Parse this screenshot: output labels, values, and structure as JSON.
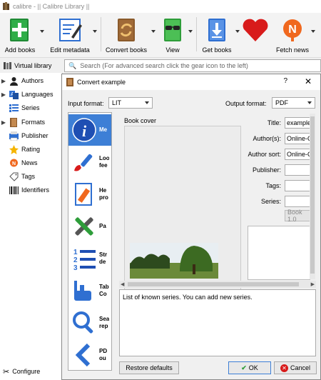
{
  "app": {
    "title": "calibre - || Calibre Library ||"
  },
  "toolbar": {
    "add_books": "Add books",
    "edit_metadata": "Edit metadata",
    "convert_books": "Convert books",
    "view": "View",
    "get_books": "Get books",
    "fetch_news": "Fetch news"
  },
  "search": {
    "virtual_library": "Virtual library",
    "placeholder": "Search (For advanced search click the gear icon to the left)"
  },
  "sidebar": {
    "items": [
      {
        "label": "Authors",
        "icon": "person-icon"
      },
      {
        "label": "Languages",
        "icon": "languages-icon"
      },
      {
        "label": "Series",
        "icon": "series-icon"
      },
      {
        "label": "Formats",
        "icon": "book-icon"
      },
      {
        "label": "Publisher",
        "icon": "publisher-icon"
      },
      {
        "label": "Rating",
        "icon": "star-icon"
      },
      {
        "label": "News",
        "icon": "news-icon"
      },
      {
        "label": "Tags",
        "icon": "tag-icon"
      },
      {
        "label": "Identifiers",
        "icon": "barcode-icon"
      }
    ],
    "configure": "Configure"
  },
  "dialog": {
    "title": "Convert example",
    "help": "?",
    "close": "✕",
    "input_format_label": "Input format:",
    "input_format_value": "LIT",
    "output_format_label": "Output format:",
    "output_format_value": "PDF",
    "categories": [
      {
        "label": "Me",
        "icon": "info-icon"
      },
      {
        "label": "Loo fee",
        "icon": "brush-icon"
      },
      {
        "label": "He pro",
        "icon": "page-setup-icon"
      },
      {
        "label": "Pa",
        "icon": "tools-icon"
      },
      {
        "label": "Str de",
        "icon": "numbered-list-icon"
      },
      {
        "label": "Tab Co",
        "icon": "toc-icon"
      },
      {
        "label": "Sea rep",
        "icon": "search-replace-icon"
      },
      {
        "label": "PD ou",
        "icon": "pdf-output-icon"
      },
      {
        "label": "",
        "icon": "debug-icon"
      }
    ],
    "book_cover_label": "Book cover",
    "metadata": {
      "title_label": "Title:",
      "title_value": "example",
      "authors_label": "Author(s):",
      "authors_value": "Online-C",
      "author_sort_label": "Author sort:",
      "author_sort_value": "Online-C",
      "publisher_label": "Publisher:",
      "tags_label": "Tags:",
      "series_label": "Series:",
      "book_number": "Book 1.0"
    },
    "help_text": "List of known series. You can add new series.",
    "restore_defaults": "Restore defaults",
    "ok": "OK",
    "cancel": "Cancel"
  },
  "colors": {
    "selection": "#3d7fd6",
    "heart": "#d81b1b",
    "green": "#2e9d3a",
    "blue": "#2f6fd1",
    "orange": "#f0681e"
  }
}
